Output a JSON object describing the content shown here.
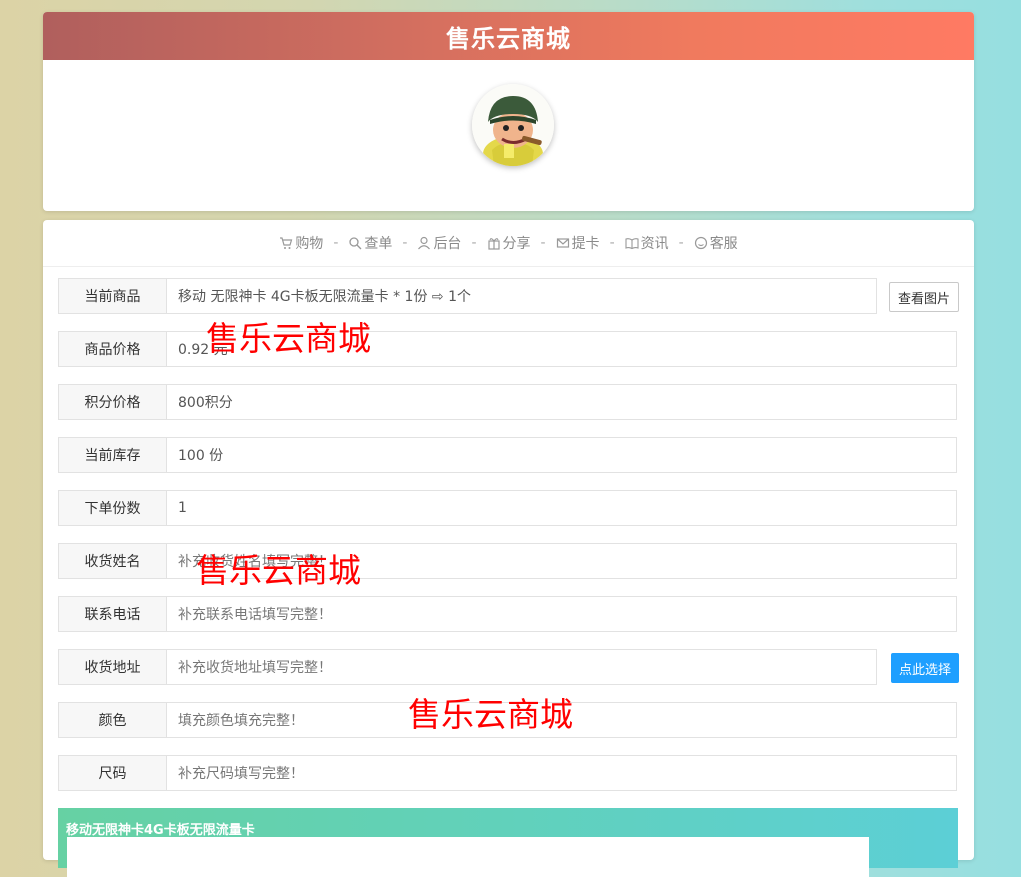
{
  "header": {
    "title": "售乐云商城"
  },
  "nav": {
    "items": [
      {
        "label": "购物",
        "icon": "cart-icon"
      },
      {
        "label": "查单",
        "icon": "search-icon"
      },
      {
        "label": "后台",
        "icon": "user-icon"
      },
      {
        "label": "分享",
        "icon": "gift-icon"
      },
      {
        "label": "提卡",
        "icon": "mail-icon"
      },
      {
        "label": "资讯",
        "icon": "book-icon"
      },
      {
        "label": "客服",
        "icon": "smile-icon"
      }
    ],
    "separator": "-"
  },
  "form": {
    "product": {
      "label": "当前商品",
      "value": "移动 无限神卡 4G卡板无限流量卡 * 1份 ⇨ 1个"
    },
    "price": {
      "label": "商品价格",
      "value": "0.92 元"
    },
    "points": {
      "label": "积分价格",
      "value": "800积分"
    },
    "stock": {
      "label": "当前库存",
      "value": "100 份"
    },
    "quantity": {
      "label": "下单份数",
      "value": "1"
    },
    "name": {
      "label": "收货姓名",
      "placeholder": "补充收货姓名填写完整！"
    },
    "phone": {
      "label": "联系电话",
      "placeholder": "补充联系电话填写完整！"
    },
    "address": {
      "label": "收货地址",
      "placeholder": "补充收货地址填写完整！"
    },
    "color": {
      "label": "颜色",
      "placeholder": "填充颜色填充完整！"
    },
    "size": {
      "label": "尺码",
      "placeholder": "补充尺码填写完整！"
    }
  },
  "buttons": {
    "view_image": "查看图片",
    "select_here": "点此选择"
  },
  "watermark": "售乐云商城",
  "promo": {
    "title": "移动无限神卡4G卡板无限流量卡"
  },
  "colors": {
    "header_start": "#b05f5d",
    "header_end": "#ff7a63",
    "primary_button": "#1e9fff",
    "watermark": "#ff0000"
  }
}
